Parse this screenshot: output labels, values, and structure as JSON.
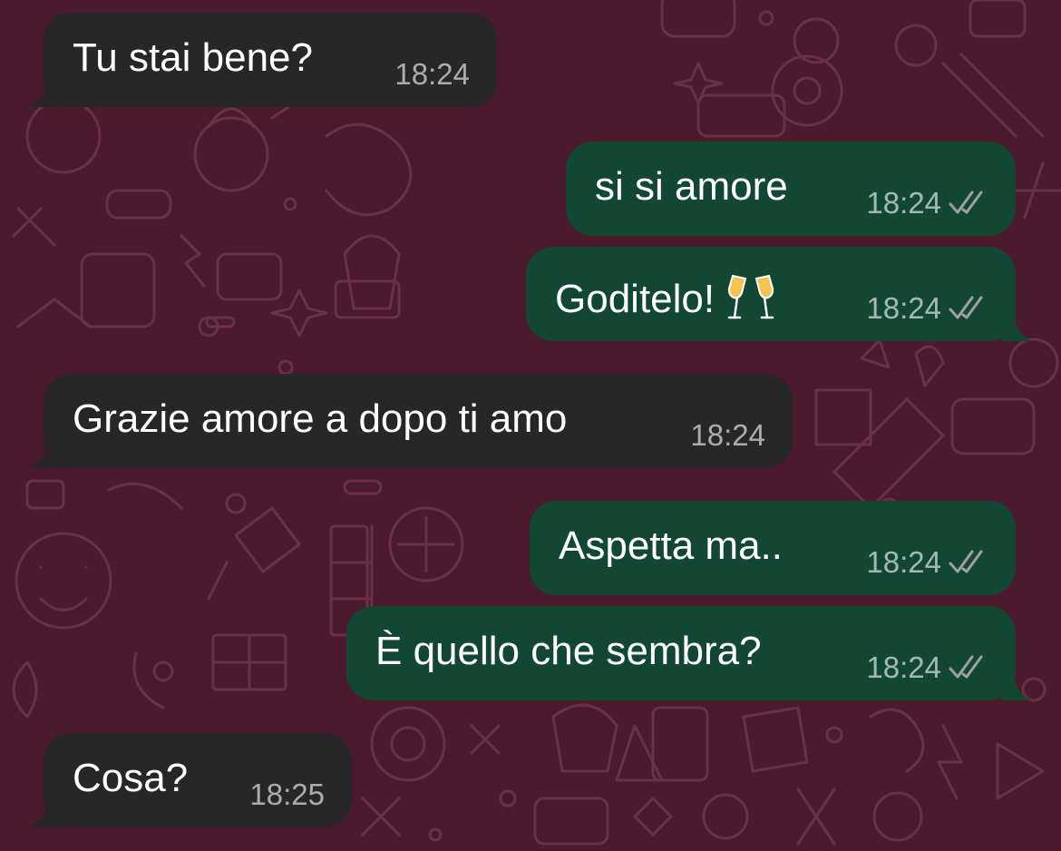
{
  "messages": [
    {
      "direction": "in",
      "text": "Tu stai bene?",
      "time": "18:24"
    },
    {
      "direction": "out",
      "text": "si si amore",
      "time": "18:24",
      "status": "read-double-check-icon"
    },
    {
      "direction": "out",
      "text": "Goditelo!",
      "emoji": "clinking-glasses-icon",
      "time": "18:24",
      "status": "read-double-check-icon"
    },
    {
      "direction": "in",
      "text": "Grazie amore a dopo ti amo",
      "time": "18:24"
    },
    {
      "direction": "out",
      "text": "Aspetta ma..",
      "time": "18:24",
      "status": "read-double-check-icon"
    },
    {
      "direction": "out",
      "text": "È quello che sembra?",
      "time": "18:24",
      "status": "read-double-check-icon"
    },
    {
      "direction": "in",
      "text": "Cosa?",
      "time": "18:25"
    }
  ],
  "colors": {
    "background": "#4c1a2e",
    "incoming_bubble": "#272727",
    "outgoing_bubble": "#124733",
    "message_text": "#ffffff",
    "timestamp": "#a8a8a8"
  }
}
